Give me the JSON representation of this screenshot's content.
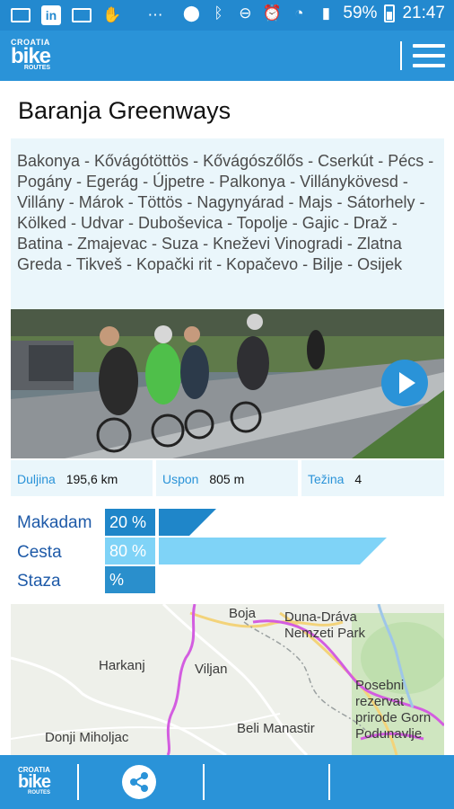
{
  "status_bar": {
    "battery": "59%",
    "time": "21:47",
    "icons": [
      "mail-icon",
      "linkedin-icon",
      "mail-icon",
      "hand-icon",
      "more-icon",
      "location-icon",
      "bluetooth-icon",
      "dnd-icon",
      "alarm-icon",
      "wifi-icon",
      "signal-icon",
      "battery-icon"
    ]
  },
  "app_bar": {
    "logo_top": "CROATIA",
    "logo_main": "bike",
    "logo_bottom": "ROUTES",
    "menu_icon": "hamburger-icon"
  },
  "route": {
    "title": "Baranja Greenways",
    "places": "Bakonya - Kővágótöttös - Kővágószőlős - Cserkút - Pécs - Pogány - Egerág - Újpetre - Palkonya - Villánykövesd - Villány - Márok - Töttös - Nagynyárad - Majs - Sátorhely - Kölked - Udvar - Duboševica - Topolje - Gajic - Draž - Batina - Zmajevac - Suza - Kneževi Vinogradi - Zlatna Greda - Tikveš - Kopački rit - Kopačevo - Bilje - Osijek"
  },
  "stats": {
    "length_label": "Duljina",
    "length_value": "195,6 km",
    "climb_label": "Uspon",
    "climb_value": "805 m",
    "difficulty_label": "Težina",
    "difficulty_value": "4"
  },
  "surface": [
    {
      "label": "Makadam",
      "percent_text": "20 %",
      "fraction": 0.2,
      "color": "#1f86c9",
      "box_color": "#1f86c9"
    },
    {
      "label": "Cesta",
      "percent_text": "80 %",
      "fraction": 0.8,
      "color": "#7fd3f7",
      "box_color": "#7fd3f7"
    },
    {
      "label": "Staza",
      "percent_text": "%",
      "fraction": 0,
      "color": "#2a8fcc",
      "box_color": "#2a8fcc"
    }
  ],
  "map": {
    "labels": [
      "Boja",
      "Duna-Dráva Nemzeti Park",
      "Harkanj",
      "Viljan",
      "Posebni rezervat prirode Gorn Podunavlje",
      "Beli Manastir",
      "Donji Miholjac"
    ]
  },
  "bottom_bar": {
    "logo_top": "CROATIA",
    "logo_main": "bike",
    "logo_bottom": "ROUTES",
    "share_icon": "share-icon"
  },
  "colors": {
    "primary": "#2a93d8",
    "status_bar": "#2389cf",
    "panel": "#eaf6fb"
  }
}
